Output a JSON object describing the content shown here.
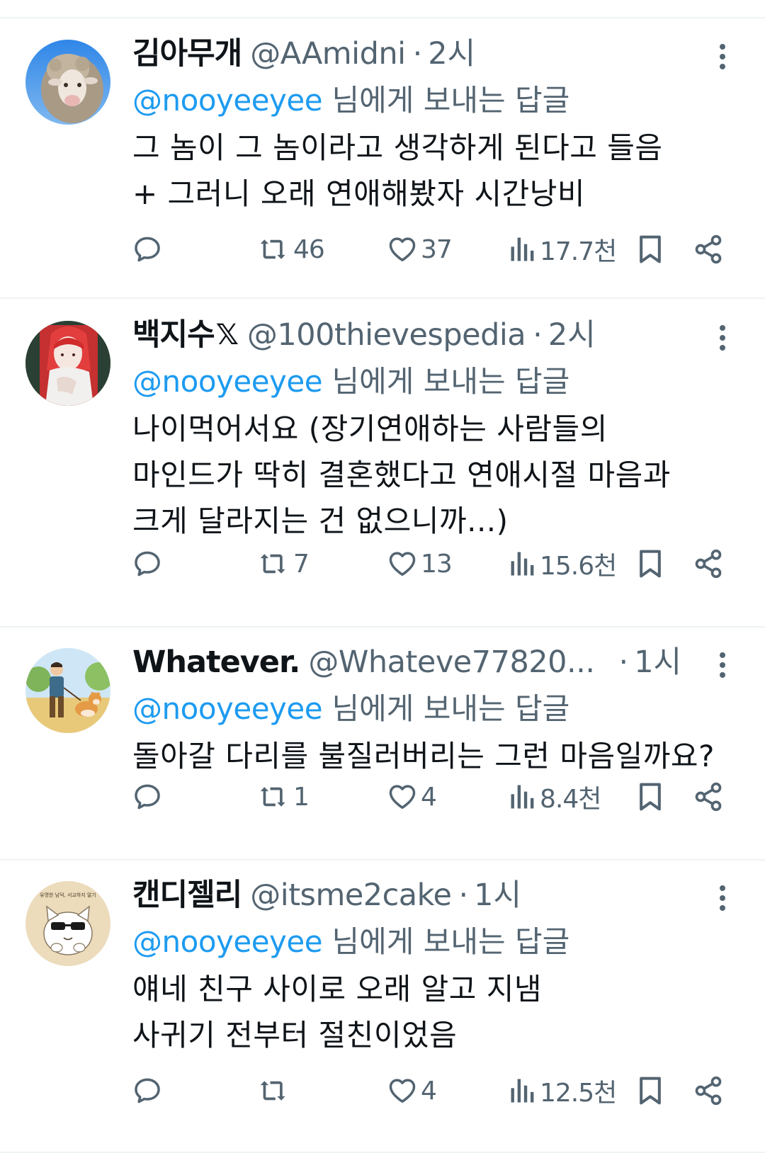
{
  "colors": {
    "text": "#0f1419",
    "secondary": "#536471",
    "mention": "#1d9bf0",
    "divider": "#eff3f4"
  },
  "tweets": [
    {
      "display_name": "김아무개",
      "verified_x": "",
      "handle": "@AAmidni",
      "dot": "·",
      "time": "2시",
      "reply_mention": "@nooyeeyee",
      "reply_suffix": " 님에게 보내는 답글",
      "text": "그 놈이 그 놈이라고 생각하게 된다고 들음\n+ 그러니 오래 연애해봤자 시간낭비",
      "retweets": "46",
      "likes": "37",
      "views": "17.7천",
      "avatar_icon": "sheep-avatar"
    },
    {
      "display_name": "백지수",
      "verified_x": "𝕏",
      "handle": "@100thievespedia",
      "dot": "·",
      "time": "2시",
      "reply_mention": "@nooyeeyee",
      "reply_suffix": " 님에게 보내는 답글",
      "text": "나이먹어서요 (장기연애하는 사람들의\n마인드가 딱히 결혼했다고 연애시절 마음과\n크게 달라지는 건 없으니까...)",
      "retweets": "7",
      "likes": "13",
      "views": "15.6천",
      "avatar_icon": "red-hair-anime-avatar"
    },
    {
      "display_name": "Whatever.",
      "verified_x": "",
      "handle": "@Whateve77820...",
      "dot": "·",
      "time": "1시",
      "reply_mention": "@nooyeeyee",
      "reply_suffix": " 님에게 보내는 답글",
      "text": "돌아갈 다리를 불질러버리는 그런 마음일까요?",
      "retweets": "1",
      "likes": "4",
      "views": "8.4천",
      "avatar_icon": "man-with-corgi-avatar"
    },
    {
      "display_name": "캔디젤리",
      "verified_x": "",
      "handle": "@itsme2cake",
      "dot": "·",
      "time": "1시",
      "reply_mention": "@nooyeeyee",
      "reply_suffix": " 님에게 보내는 답글",
      "text": "얘네 친구 사이로 오래 알고 지냄\n사귀기 전부터 절친이었음",
      "retweets": "",
      "likes": "4",
      "views": "12.5천",
      "avatar_icon": "sunglasses-cat-avatar",
      "avatar_caption": "유명한 남덕, 서교하지 말기"
    }
  ]
}
